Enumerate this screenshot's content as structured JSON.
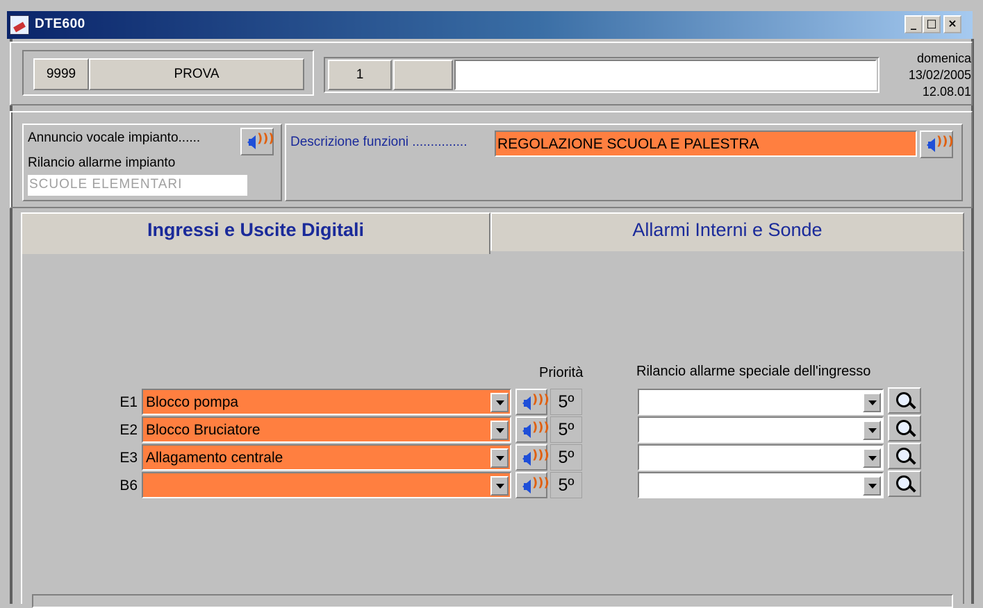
{
  "window": {
    "title": "DTE600",
    "minimize": "_",
    "maximize": "□",
    "close": "×"
  },
  "header": {
    "code": "9999",
    "name": "PROVA",
    "number": "1",
    "blank": "",
    "day": "domenica",
    "date": "13/02/2005",
    "time": "12.08.01"
  },
  "info": {
    "voice_label": "Annuncio vocale impianto......",
    "alarm_label": "Rilancio allarme impianto",
    "plant": "SCUOLE ELEMENTARI",
    "desc_label": "Descrizione funzioni ...............",
    "desc_value": "REGOLAZIONE SCUOLA E PALESTRA"
  },
  "tabs": [
    {
      "label": "Ingressi e Uscite Digitali",
      "active": true
    },
    {
      "label": "Allarmi Interni e Sonde",
      "active": false
    }
  ],
  "columns": {
    "priority": "Priorità",
    "special": "Rilancio allarme speciale dell'ingresso"
  },
  "rows": [
    {
      "id": "E1",
      "value": "Blocco pompa",
      "priority": "5º",
      "special": ""
    },
    {
      "id": "E2",
      "value": "Blocco Bruciatore",
      "priority": "5º",
      "special": ""
    },
    {
      "id": "E3",
      "value": "Allagamento centrale",
      "priority": "5º",
      "special": ""
    },
    {
      "id": "B6",
      "value": "",
      "priority": "5º",
      "special": ""
    }
  ],
  "colors": {
    "accent_orange": "#ff7f40",
    "title_blue": "#0a246a",
    "label_blue": "#1a2a9a"
  }
}
